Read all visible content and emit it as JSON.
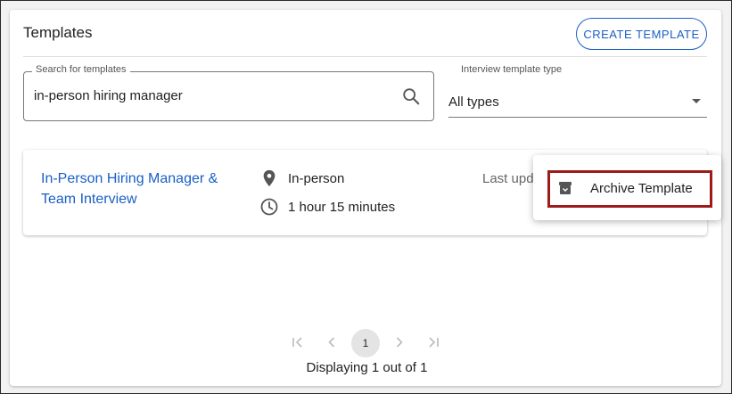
{
  "header": {
    "title": "Templates",
    "create_label": "CREATE TEMPLATE"
  },
  "search": {
    "label": "Search for templates",
    "value": "in-person hiring manager"
  },
  "type_filter": {
    "label": "Interview template type",
    "value": "All types"
  },
  "template": {
    "title": "In-Person Hiring Manager & Team Interview",
    "location": "In-person",
    "duration": "1 hour 15 minutes",
    "last_updated_label": "Last updated"
  },
  "menu": {
    "archive_label": "Archive Template"
  },
  "pagination": {
    "current_page": "1",
    "display_text": "Displaying 1 out of 1"
  },
  "colors": {
    "accent": "#1a5fc4",
    "highlight_border": "#9e1b1b"
  }
}
